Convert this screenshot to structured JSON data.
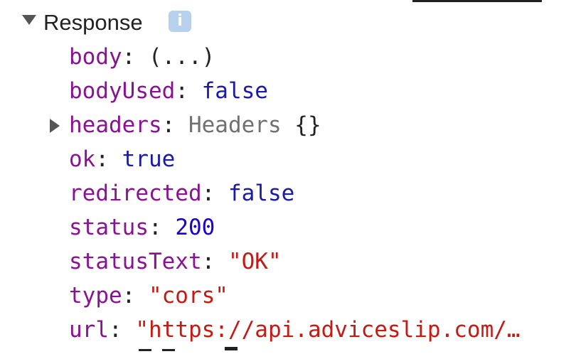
{
  "tree": {
    "root_label": "Response",
    "info_icon_glyph": "i",
    "info_icon": "info-icon",
    "toggle_icon": "triangle-down-icon",
    "properties": [
      {
        "key": "body",
        "colon": ": ",
        "value": "(...)",
        "value_type": "ellipsis"
      },
      {
        "key": "bodyUsed",
        "colon": ": ",
        "value": "false",
        "value_type": "keyword"
      },
      {
        "key": "headers",
        "colon": ": ",
        "value": "Headers",
        "value_type": "type",
        "suffix": " {}",
        "expandable": true,
        "toggle_icon": "triangle-right-icon"
      },
      {
        "key": "ok",
        "colon": ": ",
        "value": "true",
        "value_type": "keyword"
      },
      {
        "key": "redirected",
        "colon": ": ",
        "value": "false",
        "value_type": "keyword"
      },
      {
        "key": "status",
        "colon": ": ",
        "value": "200",
        "value_type": "number"
      },
      {
        "key": "statusText",
        "colon": ": ",
        "value": "\"OK\"",
        "value_type": "string"
      },
      {
        "key": "type",
        "colon": ": ",
        "value": "\"cors\"",
        "value_type": "string"
      },
      {
        "key": "url",
        "colon": ": ",
        "value": "\"https://api.adviceslip.com/…",
        "value_type": "string"
      }
    ]
  },
  "colors": {
    "key": "#881391",
    "keyword": "#1a1aa6",
    "number": "#1c00cf",
    "string": "#c41a16",
    "type": "#707070",
    "badge": "#b7d0ee"
  }
}
